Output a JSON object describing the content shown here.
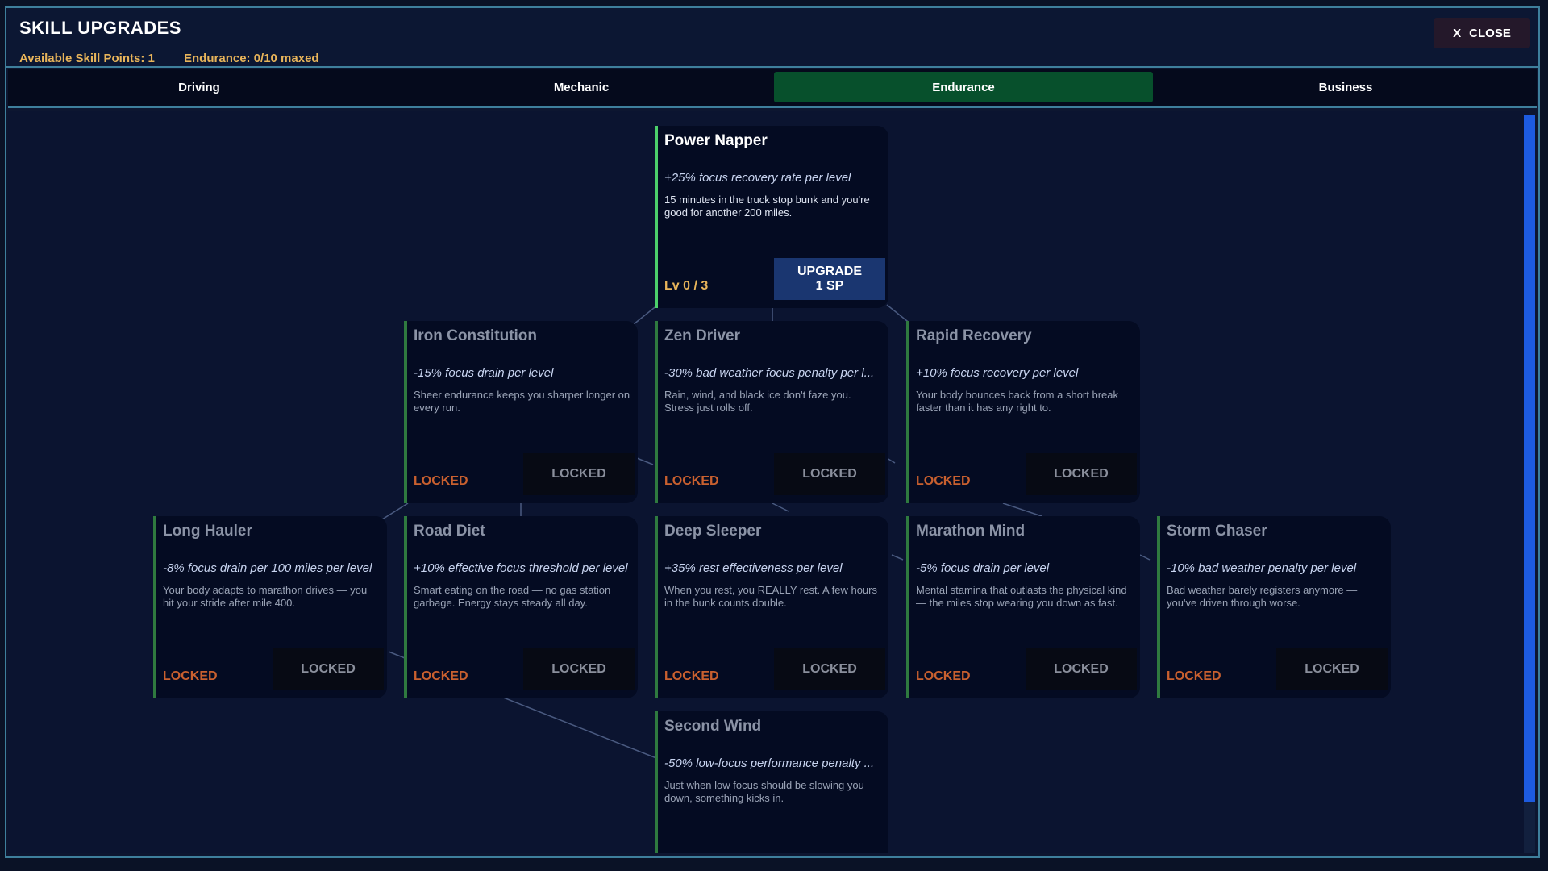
{
  "header": {
    "title": "SKILL UPGRADES",
    "available_points": "Available Skill Points: 1",
    "tree_status": "Endurance: 0/10 maxed",
    "close_icon": "X",
    "close_label": "CLOSE"
  },
  "tabs": [
    {
      "label": "Driving",
      "active": false
    },
    {
      "label": "Mechanic",
      "active": false
    },
    {
      "label": "Endurance",
      "active": true
    },
    {
      "label": "Business",
      "active": false
    }
  ],
  "colors": {
    "accent_gold": "#e8b45a",
    "locked_orange": "#c9602f",
    "active_tab": "#07502c",
    "upgrade_button": "#1a3670",
    "available_border": "#4cd06a"
  },
  "skills": {
    "power_napper": {
      "name": "Power Napper",
      "effect": "+25% focus recovery rate per level",
      "desc": "15 minutes in the truck stop bunk and you're good for another 200 miles.",
      "level": "Lv 0 / 3",
      "button": "UPGRADE\n1 SP",
      "state": "available"
    },
    "iron_constitution": {
      "name": "Iron Constitution",
      "effect": "-15% focus drain per level",
      "desc": "Sheer endurance keeps you sharper longer on every run.",
      "level": "LOCKED",
      "button": "LOCKED",
      "state": "locked"
    },
    "zen_driver": {
      "name": "Zen Driver",
      "effect": "-30% bad weather focus penalty per l...",
      "desc": "Rain, wind, and black ice don't faze you. Stress just rolls off.",
      "level": "LOCKED",
      "button": "LOCKED",
      "state": "locked"
    },
    "rapid_recovery": {
      "name": "Rapid Recovery",
      "effect": "+10% focus recovery per level",
      "desc": "Your body bounces back from a short break faster than it has any right to.",
      "level": "LOCKED",
      "button": "LOCKED",
      "state": "locked"
    },
    "long_hauler": {
      "name": "Long Hauler",
      "effect": "-8% focus drain per 100 miles per level",
      "desc": "Your body adapts to marathon drives — you hit your stride after mile 400.",
      "level": "LOCKED",
      "button": "LOCKED",
      "state": "locked"
    },
    "road_diet": {
      "name": "Road Diet",
      "effect": "+10% effective focus threshold per level",
      "desc": "Smart eating on the road — no gas station garbage. Energy stays steady all day.",
      "level": "LOCKED",
      "button": "LOCKED",
      "state": "locked"
    },
    "deep_sleeper": {
      "name": "Deep Sleeper",
      "effect": "+35% rest effectiveness per level",
      "desc": "When you rest, you REALLY rest. A few hours in the bunk counts double.",
      "level": "LOCKED",
      "button": "LOCKED",
      "state": "locked"
    },
    "marathon_mind": {
      "name": "Marathon Mind",
      "effect": "-5% focus drain per level",
      "desc": "Mental stamina that outlasts the physical kind — the miles stop wearing you down as fast.",
      "level": "LOCKED",
      "button": "LOCKED",
      "state": "locked"
    },
    "storm_chaser": {
      "name": "Storm Chaser",
      "effect": "-10% bad weather penalty per level",
      "desc": "Bad weather barely registers anymore — you've driven through worse.",
      "level": "LOCKED",
      "button": "LOCKED",
      "state": "locked"
    },
    "second_wind": {
      "name": "Second Wind",
      "effect": "-50% low-focus performance penalty ...",
      "desc": "Just when low focus should be slowing you down, something kicks in.",
      "state": "locked"
    }
  }
}
